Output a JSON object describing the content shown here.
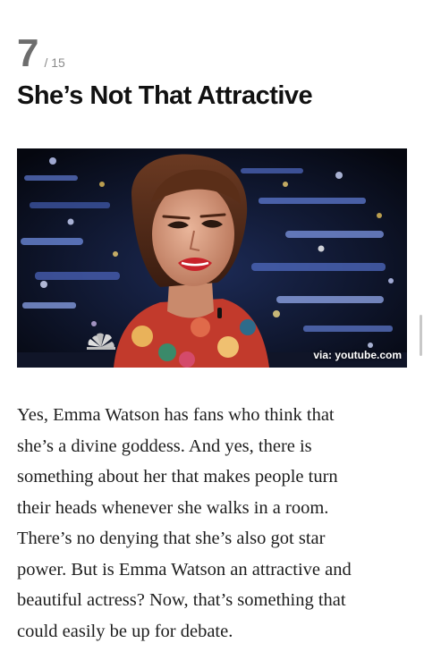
{
  "slide": {
    "number": "7",
    "total": "/ 15"
  },
  "article": {
    "title": "She’s Not That Attractive",
    "image_credit": "via: youtube.com",
    "body": "Yes, Emma Watson has fans who think that\nshe’s a divine goddess. And yes, there is\nsomething about her that makes people turn\ntheir heads whenever she walks in a room.\nThere’s no denying that she’s also got star\npower. But is Emma Watson an attractive and\nbeautiful actress? Now, that’s something that\ncould easily be up for debate."
  },
  "icons": {
    "broadcaster_logo": "peacock-logo-icon"
  }
}
